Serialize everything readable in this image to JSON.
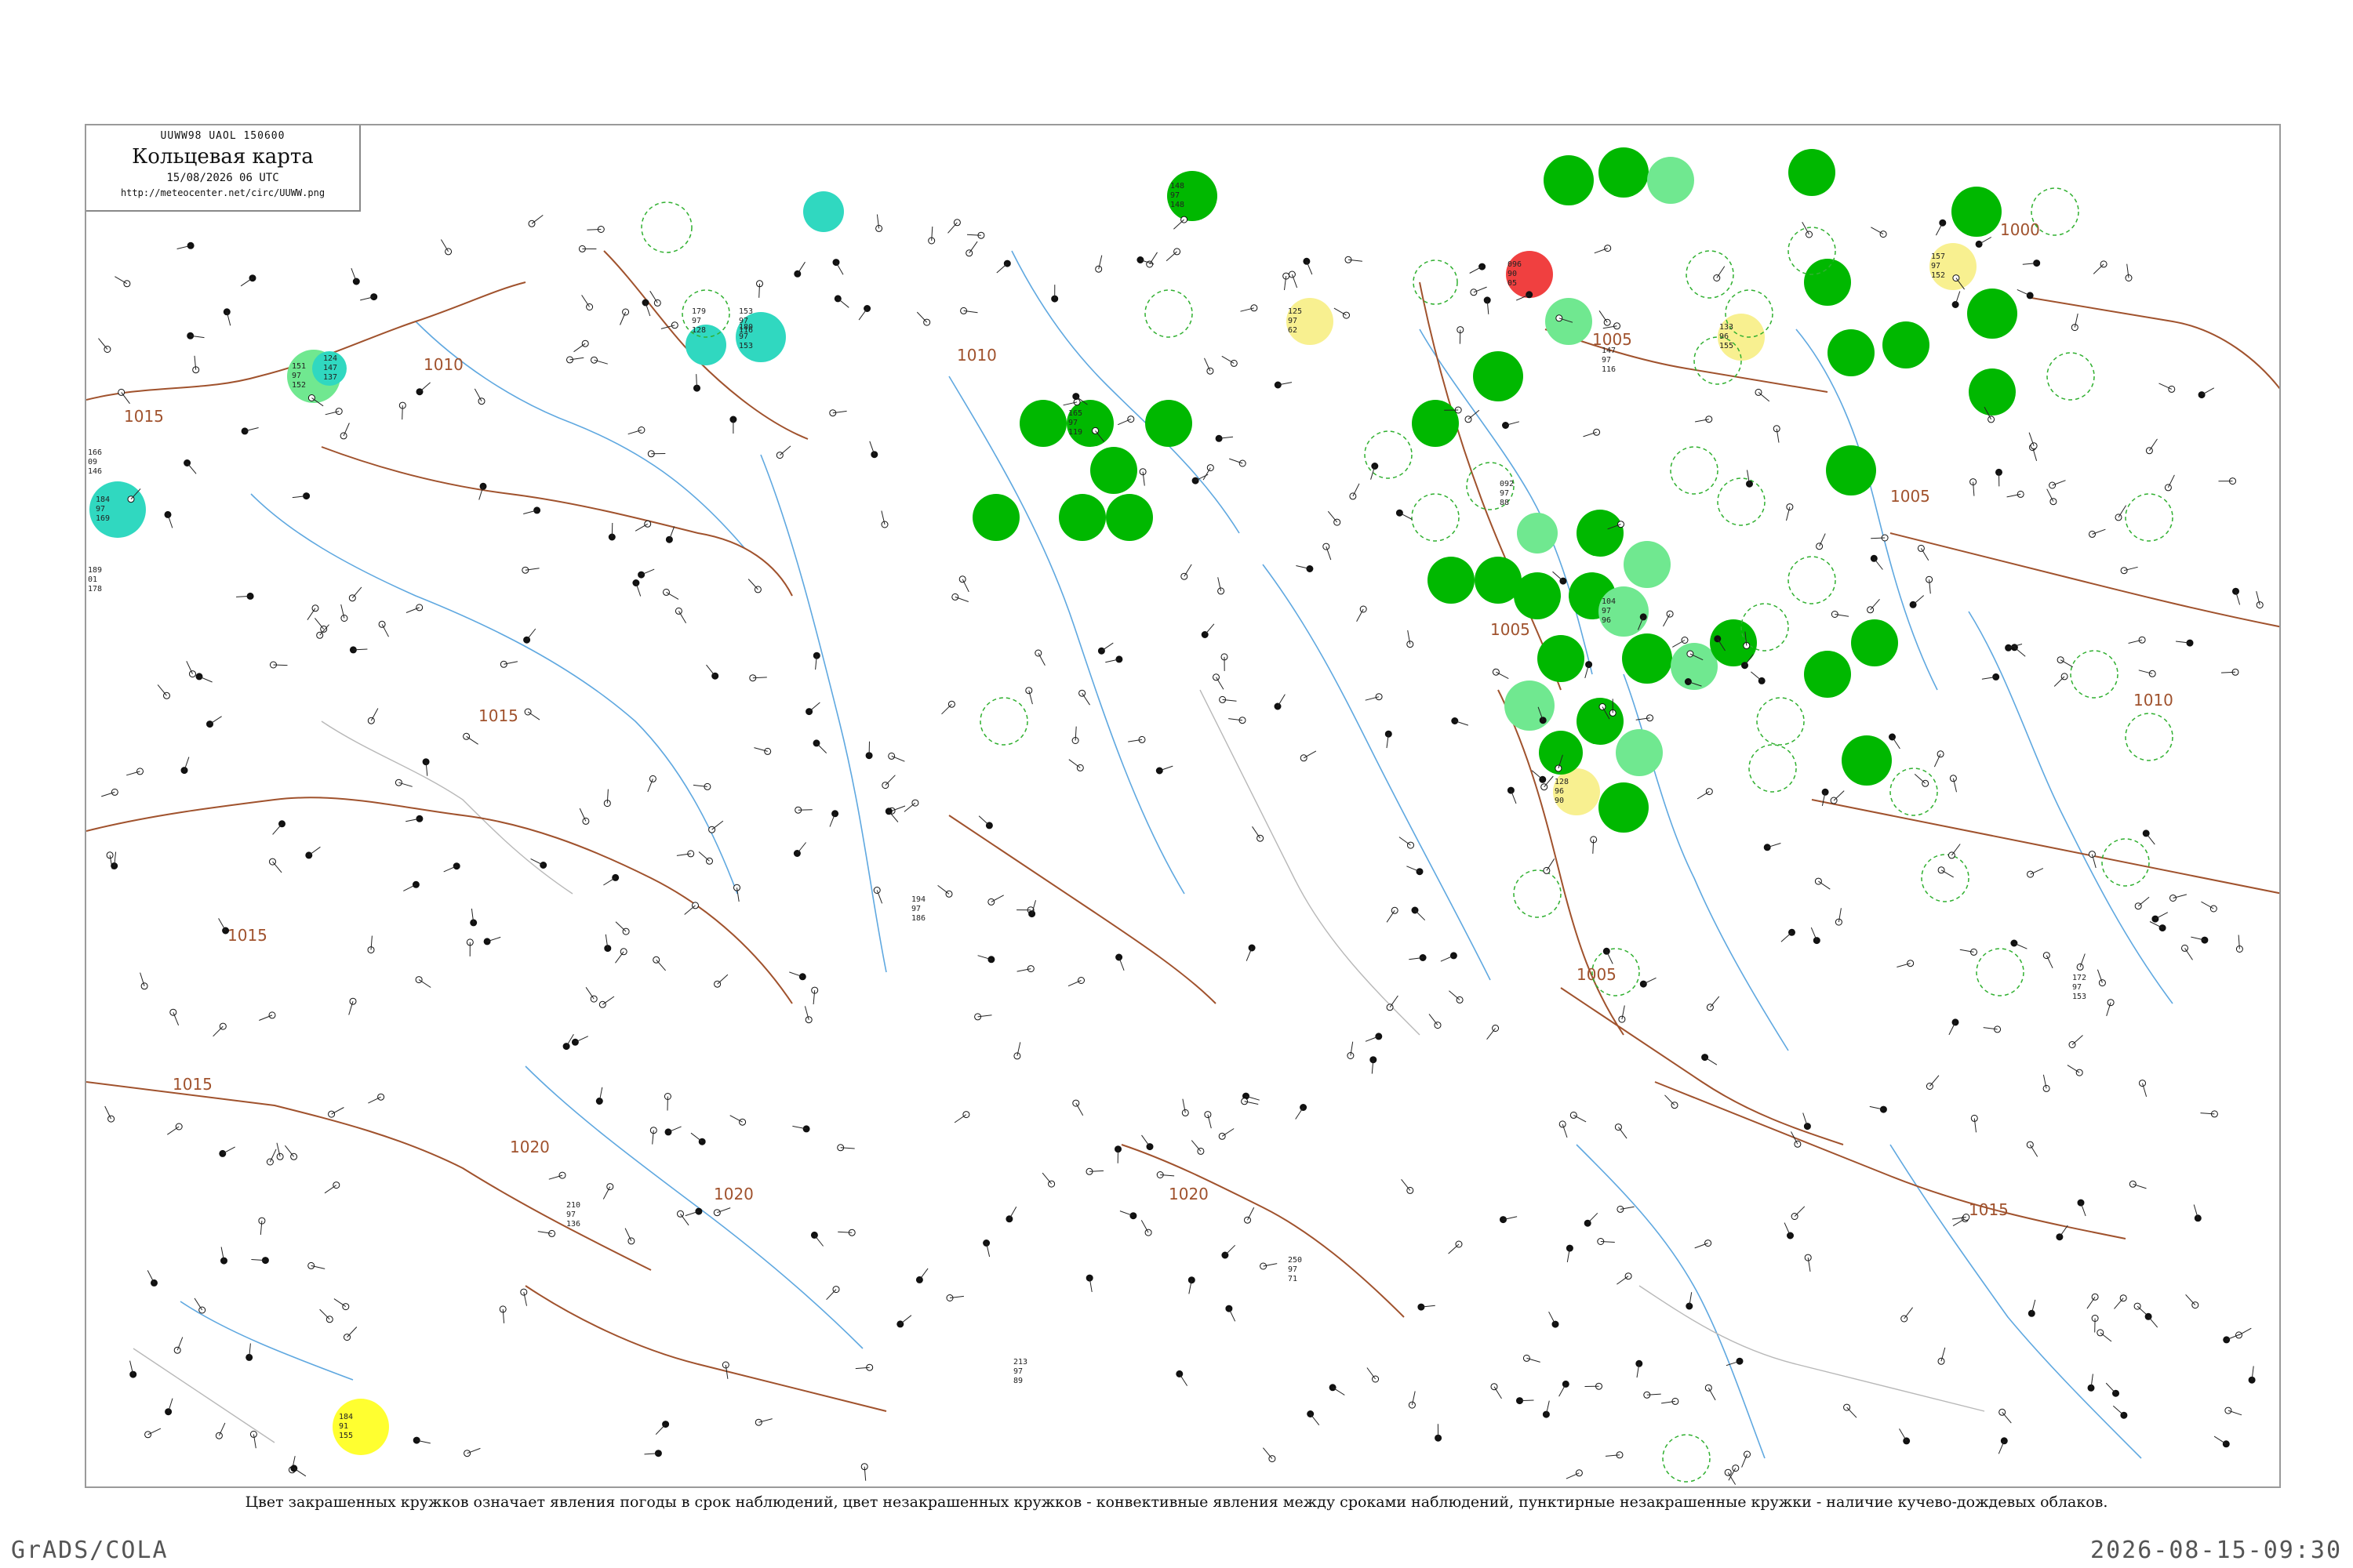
{
  "header": {
    "code": "UUWW98 UAOL 150600",
    "title": "Кольцевая карта",
    "date": "15/08/2026 06 UTC",
    "url": "http://meteocenter.net/circ/UUWW.png"
  },
  "caption": "Цвет закрашенных кружков означает явления погоды в срок наблюдений, цвет незакрашенных кружков - конвективные явления между сроками наблюдений, пунктирные незакрашенные кружки - наличие кучево-дождевых облаков.",
  "footer": {
    "left": "GrADS/COLA",
    "right": "2026-08-15-09:30"
  },
  "colors": {
    "frame": "#9a9a9a",
    "isobar": "#a0522d",
    "river": "#5fa8e0",
    "border": "#b8b8b8",
    "rain_green": "#00b800",
    "light_green": "#70e890",
    "cyan": "#30d8c0",
    "yellow": "#ffff30",
    "pale_yellow": "#f8f090",
    "red": "#f04040",
    "cb_dashed": "#30b030"
  },
  "isobars": [
    {
      "label": "1015"
    },
    {
      "label": "1010"
    },
    {
      "label": "1015"
    },
    {
      "label": "1015"
    },
    {
      "label": "1015"
    },
    {
      "label": "1020"
    },
    {
      "label": "1020"
    },
    {
      "label": "1020"
    },
    {
      "label": "1010"
    },
    {
      "label": "1005"
    },
    {
      "label": "1005"
    },
    {
      "label": "1000"
    },
    {
      "label": "1010"
    },
    {
      "label": "1015"
    },
    {
      "label": "1005"
    },
    {
      "label": "1005"
    }
  ],
  "stations": [
    {
      "t": "166",
      "p": "09",
      "d": "146"
    },
    {
      "t": "189",
      "p": "01",
      "d": "178"
    },
    {
      "t": "184",
      "p": "97",
      "d": "169"
    },
    {
      "t": "151",
      "p": "97",
      "d": "152"
    },
    {
      "t": "124",
      "p": "147",
      "d": "137"
    },
    {
      "t": "179",
      "p": "97",
      "d": "128"
    },
    {
      "t": "153",
      "p": "97",
      "d": "116"
    },
    {
      "t": "180",
      "p": "97",
      "d": "153"
    },
    {
      "t": "125",
      "p": "97",
      "d": "62"
    },
    {
      "t": "096",
      "p": "90",
      "d": "05"
    },
    {
      "t": "157",
      "p": "97",
      "d": "152"
    },
    {
      "t": "184",
      "p": "91",
      "d": "155"
    },
    {
      "t": "128",
      "p": "96",
      "d": "90"
    },
    {
      "t": "133",
      "p": "96",
      "d": "155"
    },
    {
      "t": "092",
      "p": "97",
      "d": "88"
    },
    {
      "t": "104",
      "p": "97",
      "d": "96"
    },
    {
      "t": "148",
      "p": "97",
      "d": "148"
    },
    {
      "t": "165",
      "p": "97",
      "d": "119"
    },
    {
      "t": "194",
      "p": "97",
      "d": "186"
    },
    {
      "t": "250",
      "p": "97",
      "d": "71"
    },
    {
      "t": "172",
      "p": "97",
      "d": "153"
    },
    {
      "t": "147",
      "p": "97",
      "d": "116"
    },
    {
      "t": "213",
      "p": "97",
      "d": "89"
    },
    {
      "t": "210",
      "p": "97",
      "d": "136"
    }
  ]
}
